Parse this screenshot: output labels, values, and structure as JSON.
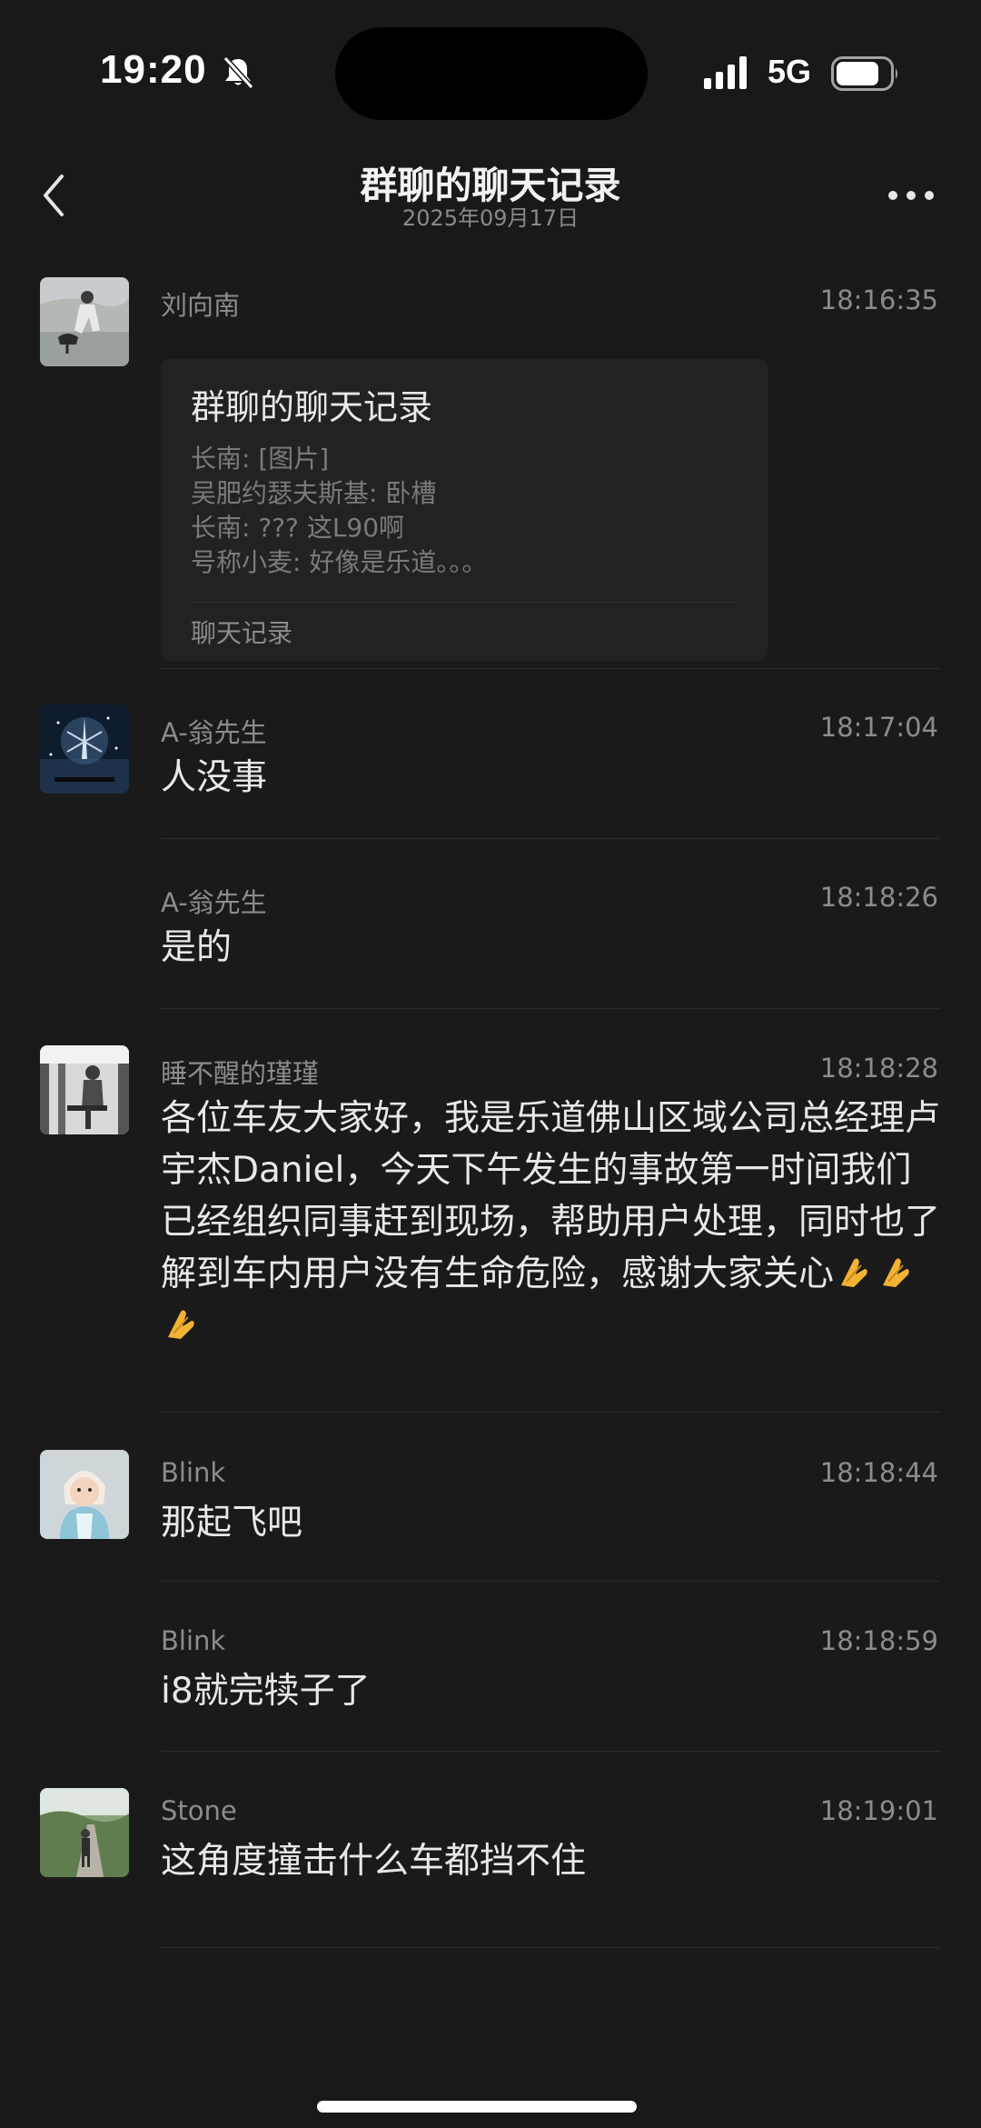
{
  "status_bar": {
    "time": "19:20",
    "network": "5G"
  },
  "header": {
    "title": "群聊的聊天记录",
    "subtitle": "2025年09月17日"
  },
  "messages": [
    {
      "sender": "刘向南",
      "time": "18:16:35",
      "card": {
        "title": "群聊的聊天记录",
        "lines": [
          "长南: [图片]",
          "吴肥约瑟夫斯基: 卧槽",
          "长南: ??? 这L90啊",
          "号称小麦: 好像是乐道。。。"
        ],
        "footer": "聊天记录"
      }
    },
    {
      "sender": "A-翁先生",
      "time": "18:17:04",
      "text": "人没事"
    },
    {
      "sender": "A-翁先生",
      "time": "18:18:26",
      "text": "是的"
    },
    {
      "sender": "睡不醒的瑾瑾",
      "time": "18:18:28",
      "text": "各位车友大家好，我是乐道佛山区域公司总经理卢宇杰Daniel，今天下午发生的事故第一时间我们已经组织同事赶到现场，帮助用户处理，同时也了解到车内用户没有生命危险，感谢大家关心"
    },
    {
      "sender": "Blink",
      "time": "18:18:44",
      "text": "那起飞吧"
    },
    {
      "sender": "Blink",
      "time": "18:18:59",
      "text": "i8就完犊子了"
    },
    {
      "sender": "Stone",
      "time": "18:19:01",
      "text": "这角度撞击什么车都挡不住"
    }
  ],
  "icons": {
    "mute": "bell-slash-icon",
    "signal": "cellular-signal-icon",
    "battery": "battery-icon",
    "back": "chevron-left-icon",
    "more": "more-dots-icon",
    "emoji": "folded-hands-emoji"
  },
  "colors": {
    "background": "#191919",
    "text_primary": "#e8e8e8",
    "text_secondary": "#8c8c8c",
    "card": "#222222"
  }
}
